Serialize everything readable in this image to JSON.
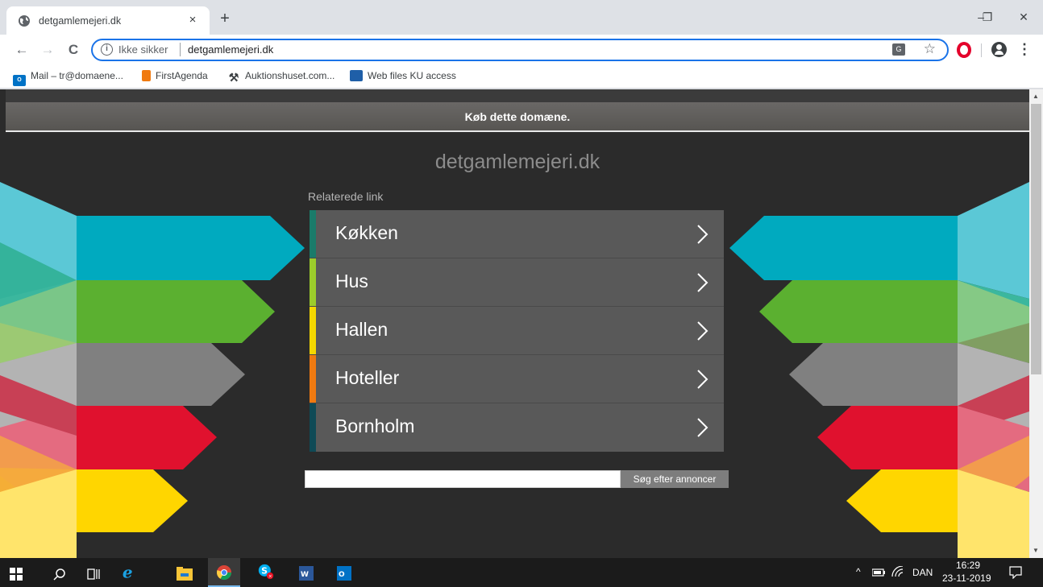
{
  "browser": {
    "tab_title": "detgamlemejeri.dk",
    "tab_close": "×",
    "new_tab": "+",
    "window_controls": {
      "minimize": "–",
      "maximize": "❐",
      "close": "✕"
    },
    "toolbar": {
      "back": "←",
      "forward": "→",
      "reload": "C",
      "security_text": "Ikke sikker",
      "url": "detgamlemejeri.dk",
      "info_glyph": "i",
      "translate_glyph": "G",
      "star": "☆",
      "menu": "⋮"
    },
    "bookmarks": [
      {
        "label": "Mail – tr@domaene...",
        "icon": "outlook-icon",
        "glyph": "O"
      },
      {
        "label": "FirstAgenda",
        "icon": "firstagenda-icon",
        "glyph": ""
      },
      {
        "label": "Auktionshuset.com...",
        "icon": "hammer-icon",
        "glyph": "⚒"
      },
      {
        "label": "Web files KU access",
        "icon": "web-files-icon",
        "glyph": "ﾞ"
      }
    ]
  },
  "page": {
    "buy_banner": "Køb dette domæne.",
    "domain_title": "detgamlemejeri.dk",
    "related_label": "Relaterede link",
    "links": [
      {
        "label": "Køkken",
        "accent": "#1a7b6a"
      },
      {
        "label": "Hus",
        "accent": "#9ccc2b"
      },
      {
        "label": "Hallen",
        "accent": "#f5d800"
      },
      {
        "label": "Hoteller",
        "accent": "#f07a10"
      },
      {
        "label": "Bornholm",
        "accent": "#0f4a56"
      }
    ],
    "search_placeholder": "",
    "search_button": "Søg efter annoncer"
  },
  "taskbar": {
    "language": "DAN",
    "time": "16:29",
    "date": "23-11-2019",
    "tray_chevron": "^"
  },
  "colors": {
    "background": "#2b2b2b",
    "link_row": "#595959",
    "accent_blue": "#1a73e8"
  }
}
